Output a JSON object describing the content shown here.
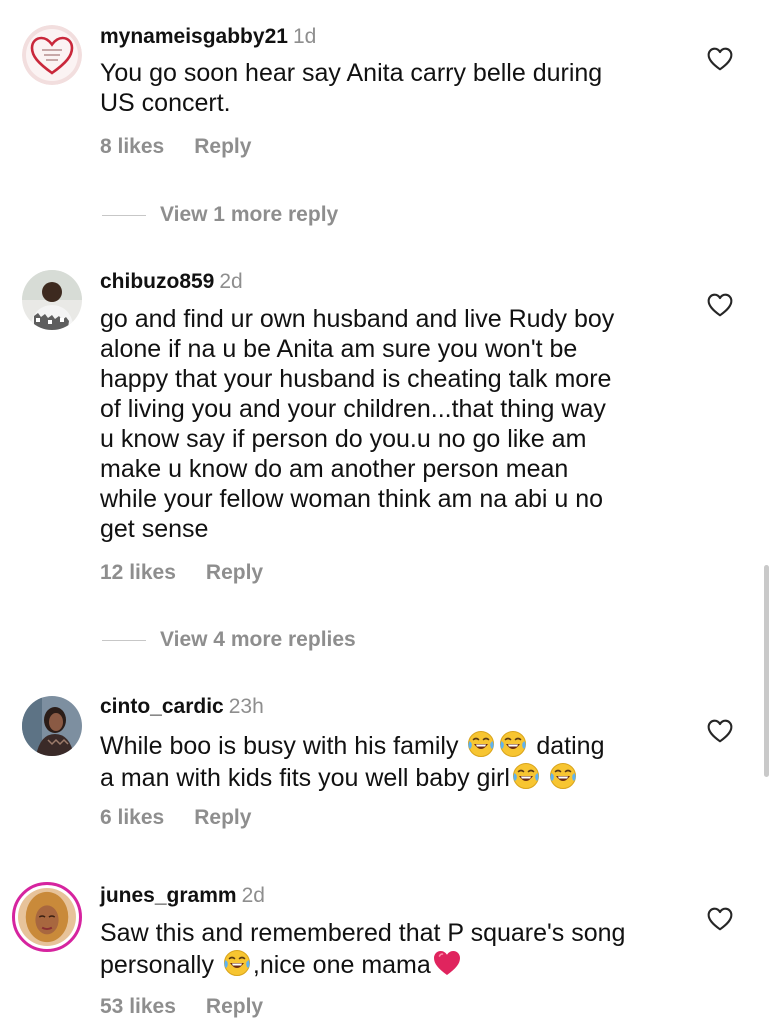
{
  "comments": [
    {
      "username": "mynameisgabby21",
      "time": "1d",
      "avatar": "heart-logo-avatar",
      "lines": [
        "You go soon hear say Anita carry belle during",
        "US concert."
      ],
      "likes": "8 likes",
      "reply": "Reply",
      "view_more": "View 1 more reply"
    },
    {
      "username": "chibuzo859",
      "time": "2d",
      "avatar": "person-photo-avatar",
      "lines": [
        "go and find ur own husband and live Rudy boy",
        "alone if na u be Anita am sure you won't be",
        "happy that your husband is cheating talk more",
        "of living you and your children...that thing way",
        "u know say if person do you.u no go like am",
        "make u know do am another person mean",
        "while your fellow woman think am na abi u no",
        "get sense"
      ],
      "likes": "12 likes",
      "reply": "Reply",
      "view_more": "View 4 more replies"
    },
    {
      "username": "cinto_cardic",
      "time": "23h",
      "avatar": "person-photo-avatar",
      "line1_a": "While boo is busy with his family ",
      "line1_b": " dating",
      "line2_a": "a man with kids fits you well baby girl",
      "likes": "6 likes",
      "reply": "Reply"
    },
    {
      "username": "junes_gramm",
      "time": "2d",
      "avatar": "story-ring-avatar",
      "line1": "Saw this and remembered that P square's song",
      "line2_a": "personally ",
      "line2_b": ",nice one mama",
      "likes": "53 likes",
      "reply": "Reply"
    }
  ],
  "icons": {
    "like": "heart-outline-icon",
    "laughing": "face-with-tears-of-joy-emoji",
    "red_heart": "red-heart-emoji"
  },
  "colors": {
    "secondary_text": "#8e8e8e",
    "primary_text": "#111111",
    "story_ring": "#d6249f",
    "heart_red": "#e0245e"
  }
}
